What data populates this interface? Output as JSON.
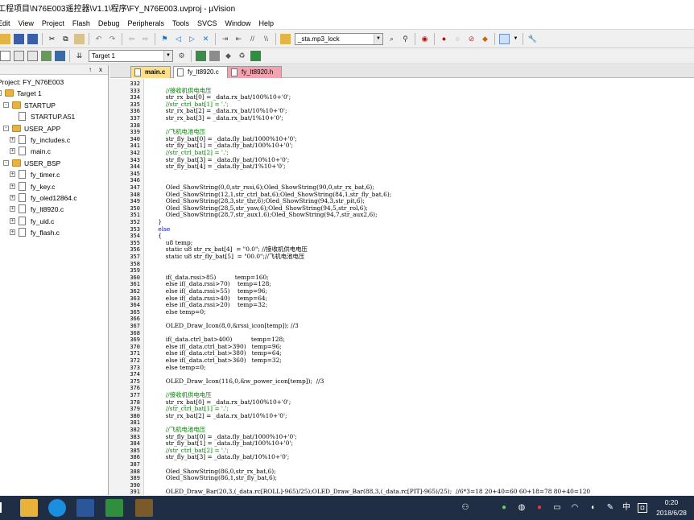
{
  "window": {
    "title": "工程项目\\N76E003遥控器\\V1.1\\程序\\FY_N76E003.uvproj - µVision"
  },
  "menu": [
    "Edit",
    "View",
    "Project",
    "Flash",
    "Debug",
    "Peripherals",
    "Tools",
    "SVCS",
    "Window",
    "Help"
  ],
  "toolbar": {
    "find_combo": "_sta.mp3_lock",
    "target_combo": "Target 1"
  },
  "project": {
    "title": "Project: FY_N76E003",
    "pin": "↑",
    "close": "x",
    "tree": [
      {
        "label": "Target 1",
        "kind": "folder",
        "level": 0,
        "expand": "-"
      },
      {
        "label": "STARTUP",
        "kind": "folder",
        "level": 1,
        "expand": "-"
      },
      {
        "label": "STARTUP.A51",
        "kind": "file",
        "level": 2,
        "expand": ""
      },
      {
        "label": "USER_APP",
        "kind": "folder",
        "level": 1,
        "expand": "-"
      },
      {
        "label": "fy_includes.c",
        "kind": "file",
        "level": 2,
        "expand": "+"
      },
      {
        "label": "main.c",
        "kind": "file",
        "level": 2,
        "expand": "+"
      },
      {
        "label": "USER_BSP",
        "kind": "folder",
        "level": 1,
        "expand": "-"
      },
      {
        "label": "fy_timer.c",
        "kind": "file",
        "level": 2,
        "expand": "+"
      },
      {
        "label": "fy_key.c",
        "kind": "file",
        "level": 2,
        "expand": "+"
      },
      {
        "label": "fy_oled12864.c",
        "kind": "file",
        "level": 2,
        "expand": "+"
      },
      {
        "label": "fy_lt8920.c",
        "kind": "file",
        "level": 2,
        "expand": "+"
      },
      {
        "label": "fy_uid.c",
        "kind": "file",
        "level": 2,
        "expand": "+"
      },
      {
        "label": "fy_flash.c",
        "kind": "file",
        "level": 2,
        "expand": "+"
      }
    ]
  },
  "editor": {
    "tabs": [
      "main.c",
      "fy_lt8920.c",
      "fy_lt8920.h"
    ],
    "lines": [
      {
        "n": "332",
        "t": ""
      },
      {
        "n": "333",
        "t": "\t\t//接收机供电电压",
        "c": "comment"
      },
      {
        "n": "334",
        "t": "\t\tstr_rx_bat[0] = _data.rx_bat/100%10+'0';"
      },
      {
        "n": "335",
        "t": "\t\t//str_ctrl_bat[1] = '.';",
        "c": "comment"
      },
      {
        "n": "336",
        "t": "\t\tstr_rx_bat[2] = _data.rx_bat/10%10+'0';"
      },
      {
        "n": "337",
        "t": "\t\tstr_rx_bat[3] = _data.rx_bat/1%10+'0';"
      },
      {
        "n": "338",
        "t": ""
      },
      {
        "n": "339",
        "t": "\t\t//飞机电池电压",
        "c": "comment"
      },
      {
        "n": "340",
        "t": "\t\tstr_fly_bat[0] = _data.fly_bat/1000%10+'0';"
      },
      {
        "n": "341",
        "t": "\t\tstr_fly_bat[1] = _data.fly_bat/100%10+'0';"
      },
      {
        "n": "342",
        "t": "\t\t//str_ctrl_bat[2] = '.';",
        "c": "comment"
      },
      {
        "n": "343",
        "t": "\t\tstr_fly_bat[3] = _data.fly_bat/10%10+'0';"
      },
      {
        "n": "344",
        "t": "\t\tstr_fly_bat[4] = _data.fly_bat/1%10+'0';"
      },
      {
        "n": "345",
        "t": ""
      },
      {
        "n": "346",
        "t": ""
      },
      {
        "n": "347",
        "t": "\t\tOled_ShowString(0,0,str_rssi,6);Oled_ShowString(90,0,str_rx_bat,6);"
      },
      {
        "n": "348",
        "t": "\t\tOled_ShowString(12,1,str_ctrl_bat,6);Oled_ShowString(84,1,str_fly_bat,6);"
      },
      {
        "n": "349",
        "t": "\t\tOled_ShowString(28,3,str_thr,6);Oled_ShowString(94,3,str_pit,6);"
      },
      {
        "n": "350",
        "t": "\t\tOled_ShowString(28,5,str_yaw,6);Oled_ShowString(94,5,str_rol,6);"
      },
      {
        "n": "351",
        "t": "\t\tOled_ShowString(28,7,str_aux1,6);Oled_ShowString(94,7,str_aux2,6);"
      },
      {
        "n": "352",
        "t": "\t}"
      },
      {
        "n": "353",
        "t": "\telse",
        "c": "keyword"
      },
      {
        "n": "354",
        "t": "\t{"
      },
      {
        "n": "355",
        "t": "\t\tu8 temp;"
      },
      {
        "n": "356",
        "t": "\t\tstatic u8 str_rx_bat[4]  = \"0.0\"; //接收机供电电压"
      },
      {
        "n": "357",
        "t": "\t\tstatic u8 str_fly_bat[5]  = \"00.0\";//飞机电池电压"
      },
      {
        "n": "358",
        "t": ""
      },
      {
        "n": "359",
        "t": ""
      },
      {
        "n": "360",
        "t": "\t\tif(_data.rssi>85)          temp=160;"
      },
      {
        "n": "361",
        "t": "\t\telse if(_data.rssi>70)    temp=128;"
      },
      {
        "n": "362",
        "t": "\t\telse if(_data.rssi>55)    temp=96;"
      },
      {
        "n": "363",
        "t": "\t\telse if(_data.rssi>40)    temp=64;"
      },
      {
        "n": "364",
        "t": "\t\telse if(_data.rssi>20)    temp=32;"
      },
      {
        "n": "365",
        "t": "\t\telse temp=0;"
      },
      {
        "n": "366",
        "t": ""
      },
      {
        "n": "367",
        "t": "\t\tOLED_Draw_Icon(8,0,&rssi_icon[temp]); //3"
      },
      {
        "n": "368",
        "t": ""
      },
      {
        "n": "369",
        "t": "\t\tif(_data.ctrl_bat>400)          temp=128;"
      },
      {
        "n": "370",
        "t": "\t\telse if(_data.ctrl_bat>390)   temp=96;"
      },
      {
        "n": "371",
        "t": "\t\telse if(_data.ctrl_bat>380)   temp=64;"
      },
      {
        "n": "372",
        "t": "\t\telse if(_data.ctrl_bat>360)   temp=32;"
      },
      {
        "n": "373",
        "t": "\t\telse temp=0;"
      },
      {
        "n": "374",
        "t": ""
      },
      {
        "n": "375",
        "t": "\t\tOLED_Draw_Icon(116,0,&w_power_icon[temp]);  //3"
      },
      {
        "n": "376",
        "t": ""
      },
      {
        "n": "377",
        "t": "\t\t//接收机供电电压",
        "c": "comment"
      },
      {
        "n": "378",
        "t": "\t\tstr_rx_bat[0] = _data.rx_bat/100%10+'0';"
      },
      {
        "n": "379",
        "t": "\t\t//str_ctrl_bat[1] = '.';",
        "c": "comment"
      },
      {
        "n": "380",
        "t": "\t\tstr_rx_bat[2] = _data.rx_bat/10%10+'0';"
      },
      {
        "n": "381",
        "t": ""
      },
      {
        "n": "382",
        "t": "\t\t//飞机电池电压",
        "c": "comment"
      },
      {
        "n": "383",
        "t": "\t\tstr_fly_bat[0] = _data.fly_bat/1000%10+'0';"
      },
      {
        "n": "384",
        "t": "\t\tstr_fly_bat[1] = _data.fly_bat/100%10+'0';"
      },
      {
        "n": "385",
        "t": "\t\t//str_ctrl_bat[2] = '.';",
        "c": "comment"
      },
      {
        "n": "386",
        "t": "\t\tstr_fly_bat[3] = _data.fly_bat/10%10+'0';"
      },
      {
        "n": "387",
        "t": ""
      },
      {
        "n": "388",
        "t": "\t\tOled_ShowString(86,0,str_rx_bat,6);"
      },
      {
        "n": "389",
        "t": "\t\tOled_ShowString(86,1,str_fly_bat,6);"
      },
      {
        "n": "390",
        "t": ""
      },
      {
        "n": "391",
        "t": "\t\tOLED_Draw_Bar(20,3,(_data.rc[ROLL]-965)/25);OLED_Draw_Bar(88,3,(_data.rc[PIT]-965)/25);  //6*3=18 20+40=60 60+18=78 80+40=120"
      }
    ]
  },
  "taskbar": {
    "ime": "中",
    "time": "0:20",
    "date": "2018/6/28",
    "apps": [
      "start-icon",
      "file-explorer-icon",
      "browser-icon",
      "word-icon",
      "keil-icon",
      "app-icon"
    ]
  },
  "colors": {
    "editor_bg": "#ffffff",
    "comment": "#008000",
    "keyword": "#0000ff",
    "tab_active": "#ffe08a",
    "tab_header": "#f1a4b0",
    "taskbar": "#1f2d45"
  }
}
